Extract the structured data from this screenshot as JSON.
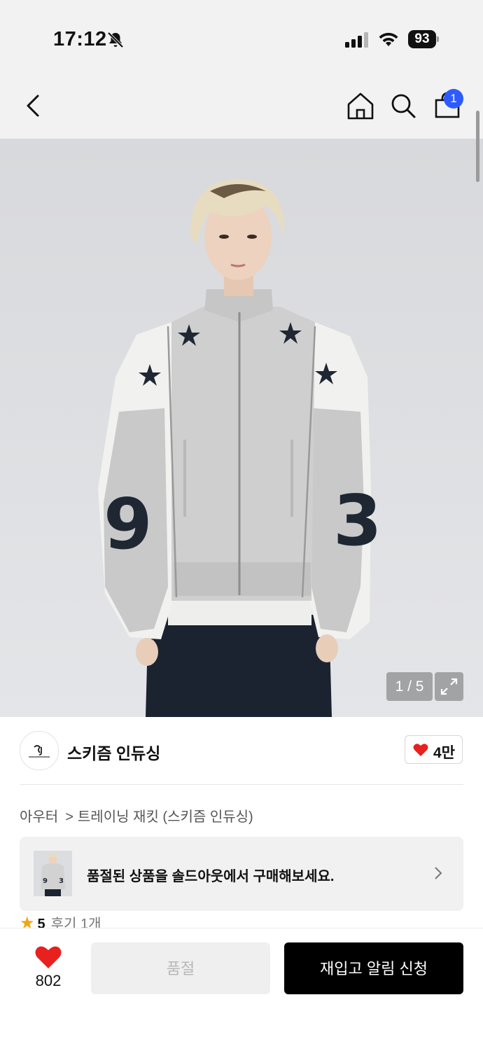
{
  "status_bar": {
    "time": "17:12",
    "battery": "93",
    "icons": [
      "bell-slash-icon",
      "cellular-signal-icon",
      "wifi-icon",
      "battery-icon"
    ]
  },
  "nav": {
    "icons": [
      "back-chevron-icon",
      "home-icon",
      "search-icon",
      "shopping-bag-icon"
    ],
    "cart_badge": "1"
  },
  "gallery": {
    "counter": "1 / 5",
    "current_page": 1,
    "total_pages": 5
  },
  "brand": {
    "name": "스키즘 인듀싱",
    "likes": "4만"
  },
  "breadcrumb": {
    "category": "아우터",
    "separator": ">",
    "product": "트레이닝 재킷 (스키즘 인듀싱)"
  },
  "soldout_banner": {
    "text": "품절된 상품을 솔드아웃에서 구매해보세요."
  },
  "rating": {
    "score": "5",
    "reviews": "후기 1개"
  },
  "bottom_bar": {
    "wish_count": "802",
    "soldout_label": "품절",
    "restock_label": "재입고 알림 신청"
  },
  "colors": {
    "accent_badge": "#2d5bff",
    "heart": "#e8201e",
    "star": "#f4a40e",
    "primary_button": "#000000"
  }
}
